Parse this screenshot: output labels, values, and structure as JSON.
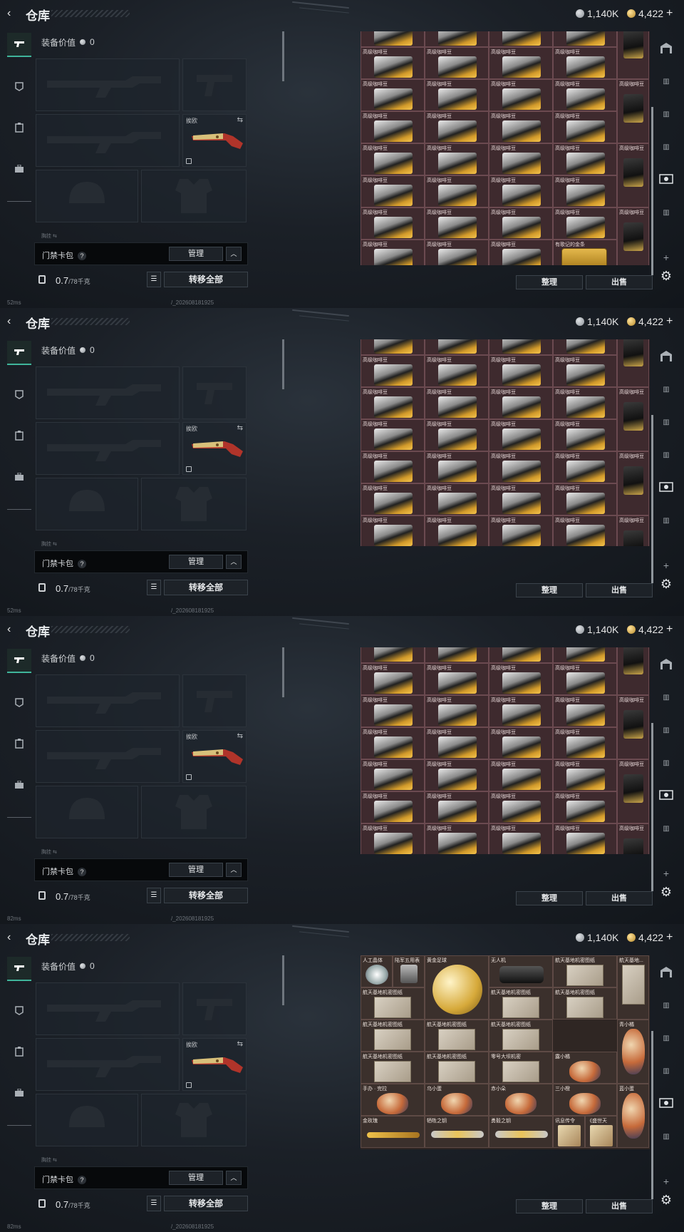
{
  "topbar": {
    "title": "仓库",
    "silver": "1,140K",
    "gold": "4,422",
    "plus": "+",
    "back": "‹"
  },
  "left_nav": {
    "items": [
      "weapon-icon",
      "armor-icon",
      "clipboard-icon",
      "briefcase-icon"
    ]
  },
  "equipment": {
    "value_label": "装备价值",
    "value": "0",
    "secondary_tag": "挨欧",
    "swap_icon": "⇆",
    "hint": "胸挂  ⇆",
    "pouch": {
      "label": "门禁卡包",
      "help": "?",
      "manage": "管理",
      "collapse": "︿"
    },
    "weight": {
      "current": "0.7",
      "max": "/78千克"
    },
    "list_icon": "☰",
    "transfer_all": "转移全部"
  },
  "inventory": {
    "sort": "整理",
    "sell": "出售",
    "coffee_label": "高级咖啡豆",
    "coffee_bag_label": "高级咖啡豆",
    "gold_label": "有歌记的金条",
    "collect_items": [
      {
        "name": "人工晶体"
      },
      {
        "name": "陆军五用表"
      },
      {
        "name": "黄金足球"
      },
      {
        "name": "无人机"
      },
      {
        "name": "航天基地机密图纸"
      },
      {
        "name": "航天基地..."
      },
      {
        "name": "航天基地机密图纸"
      },
      {
        "name": "航天基地机密图纸"
      },
      {
        "name": "航天基地机密图纸"
      },
      {
        "name": "航天基地机密图纸"
      },
      {
        "name": "航天基地机密图纸"
      },
      {
        "name": "航天基地机密图纸"
      },
      {
        "name": "青小橘"
      },
      {
        "name": "航天基地机密图纸"
      },
      {
        "name": "航天基地机密图纸"
      },
      {
        "name": "零号大坝机密"
      },
      {
        "name": "露小橘"
      },
      {
        "name": "手办 · 完拉"
      },
      {
        "name": "乌小蛋"
      },
      {
        "name": "赤小朵"
      },
      {
        "name": "三小橙"
      },
      {
        "name": "蓝小蛋"
      },
      {
        "name": "金玫瑰"
      },
      {
        "name": "牺牲之钥"
      },
      {
        "name": "勇毅之钥"
      },
      {
        "name": "讯息传令"
      },
      {
        "name": "《盛世天"
      }
    ]
  },
  "right_nav": {
    "items": [
      "garage-icon",
      "slot-icon",
      "slot-icon",
      "slot-icon",
      "slot-icon",
      "camera-icon",
      "slot-icon"
    ],
    "add": "+",
    "gear": "⚙"
  },
  "status": {
    "left": "52ms",
    "left2": "82ms",
    "build": "/_202608181925"
  }
}
